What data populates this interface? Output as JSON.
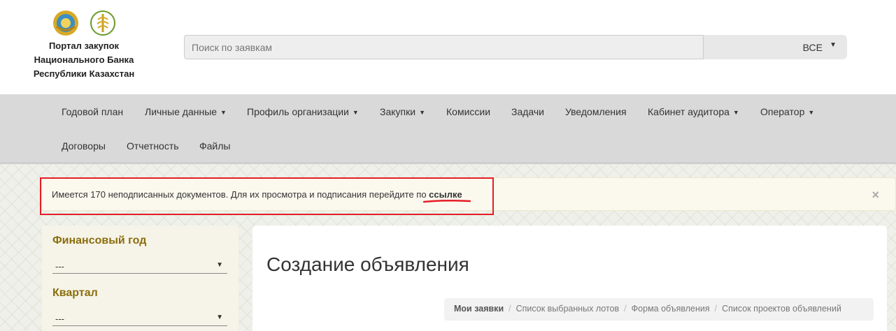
{
  "header": {
    "title_lines": [
      "Портал закупок",
      "Национального Банка",
      "Республики Казахстан"
    ],
    "search": {
      "placeholder": "Поиск по заявкам",
      "value": ""
    },
    "filter": {
      "selected": "ВСЕ"
    }
  },
  "nav": {
    "items": [
      {
        "label": "Годовой план",
        "dropdown": false
      },
      {
        "label": "Личные данные",
        "dropdown": true
      },
      {
        "label": "Профиль организации",
        "dropdown": true
      },
      {
        "label": "Закупки",
        "dropdown": true
      },
      {
        "label": "Комиссии",
        "dropdown": false
      },
      {
        "label": "Задачи",
        "dropdown": false
      },
      {
        "label": "Уведомления",
        "dropdown": false
      },
      {
        "label": "Кабинет аудитора",
        "dropdown": true
      },
      {
        "label": "Оператор",
        "dropdown": true
      },
      {
        "label": "Договоры",
        "dropdown": false
      },
      {
        "label": "Отчетность",
        "dropdown": false
      },
      {
        "label": "Файлы",
        "dropdown": false
      }
    ]
  },
  "alert": {
    "text": "Имеется 170 неподписанных документов. Для их просмотра и подписания перейдите по ",
    "link": "ссылке",
    "close": "×"
  },
  "sidebar": {
    "filters": [
      {
        "label": "Финансовый год",
        "value": "---"
      },
      {
        "label": "Квартал",
        "value": "---"
      }
    ]
  },
  "main": {
    "title": "Создание объявления",
    "breadcrumb": [
      "Мои заявки",
      "Список выбранных лотов",
      "Форма объявления",
      "Список проектов объявлений"
    ]
  },
  "colors": {
    "accent_label": "#8a6d0e",
    "annotation_red": "#e51d24",
    "navbar_bg": "#d9d9d9"
  }
}
